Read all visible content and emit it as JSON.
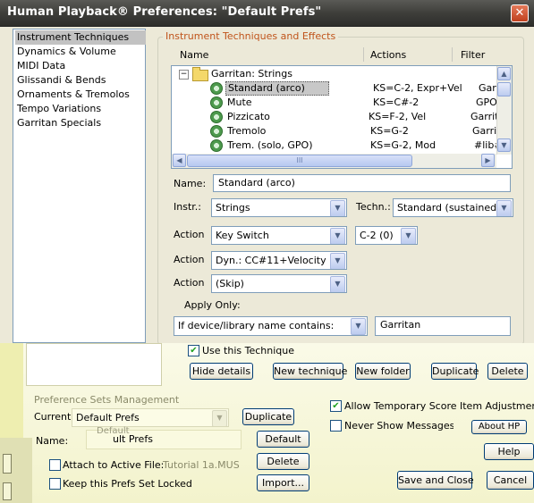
{
  "window": {
    "title": "Human Playback® Preferences: \"Default Prefs\"",
    "close_glyph": "✕"
  },
  "categories": [
    "Instrument Techniques",
    "Dynamics & Volume",
    "MIDI Data",
    "Glissandi & Bends",
    "Ornaments & Tremolos",
    "Tempo Variations",
    "Garritan Specials"
  ],
  "group": {
    "label": "Instrument Techniques and Effects"
  },
  "columns": {
    "name": "Name",
    "actions": "Actions",
    "filter": "Filter"
  },
  "tree": {
    "root": {
      "label": "Garritan: Strings"
    },
    "rows": [
      {
        "name": "Standard (arco)",
        "actions": "KS=C-2, Expr+Vel",
        "filter": "Garr"
      },
      {
        "name": "Mute",
        "actions": "KS=C#-2",
        "filter": "GPO"
      },
      {
        "name": "Pizzicato",
        "actions": "KS=F-2, Vel",
        "filter": "Garrit"
      },
      {
        "name": "Tremolo",
        "actions": "KS=G-2",
        "filter": "Garrit"
      },
      {
        "name": "Trem. (solo, GPO)",
        "actions": "KS=G-2, Mod",
        "filter": "#lib#"
      }
    ],
    "hscroll_grip": "III"
  },
  "form": {
    "name_label": "Name:",
    "name_value": "Standard (arco)",
    "instr_label": "Instr.:",
    "instr_value": "Strings",
    "techn_label": "Techn.:",
    "techn_value": "Standard (sustained)",
    "action_label": "Action",
    "action1_value": "Key Switch",
    "action1_extra": "C-2 (0)",
    "action2_value": "Dyn.: CC#11+Velocity",
    "action3_value": "(Skip)",
    "apply_only_label": "Apply Only:",
    "apply_condition": "If device/library name contains:",
    "apply_value": "Garritan",
    "use_technique": "Use this Technique"
  },
  "buttons": {
    "hide_details": "Hide details",
    "new_technique": "New technique",
    "new_folder": "New folder",
    "duplicate": "Duplicate",
    "delete": "Delete",
    "about": "About HP",
    "default": "Default",
    "delete2": "Delete",
    "import": "Import...",
    "help": "Help",
    "save_close": "Save and Close",
    "cancel": "Cancel",
    "duplicate2": "Duplicate"
  },
  "prefs": {
    "section_label": "Preference Sets Management",
    "current_label": "Current:",
    "current_value": "Default Prefs",
    "name_label": "Name:",
    "name_value": "ult Prefs",
    "name_overlay": "Default",
    "attach_label": "Attach to Active File:",
    "attach_file": "Tutorial 1a.MUS",
    "locked_label": "Keep this Prefs Set Locked",
    "allow_temp": "Allow Temporary Score Item Adjustments",
    "never_show": "Never Show Messages"
  },
  "arrows": {
    "down": "▼",
    "up": "▲",
    "left": "◀",
    "right": "▶",
    "check": "✔",
    "minus": "−"
  }
}
